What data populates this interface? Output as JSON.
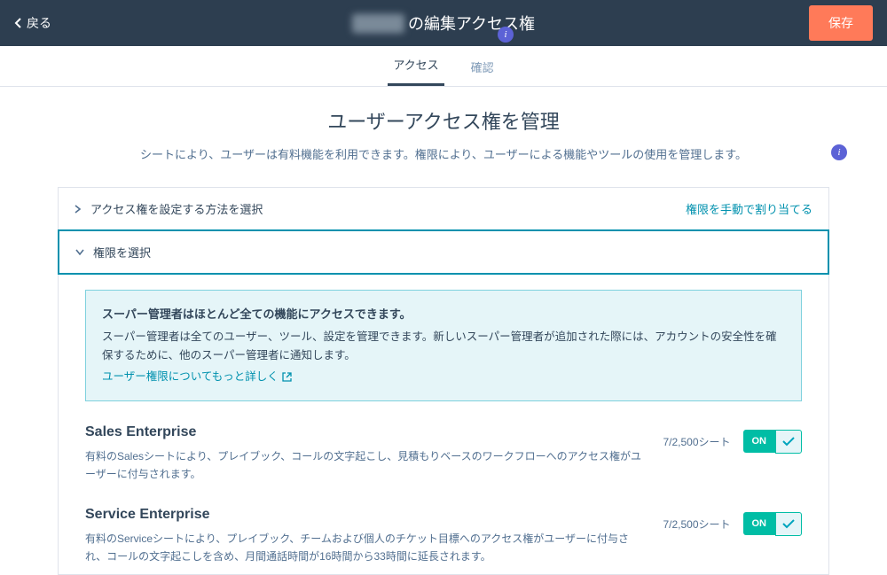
{
  "topbar": {
    "back": "戻る",
    "title_suffix": "の編集アクセス権",
    "save": "保存"
  },
  "tabs": {
    "access": "アクセス",
    "confirm": "確認"
  },
  "page": {
    "headline": "ユーザーアクセス権を管理",
    "subhead": "シートにより、ユーザーは有料機能を利用できます。権限により、ユーザーによる機能やツールの使用を管理します。"
  },
  "sections": {
    "method": "アクセス権を設定する方法を選択",
    "method_link": "権限を手動で割り当てる",
    "select": "権限を選択"
  },
  "callout": {
    "strong": "スーパー管理者はほとんど全ての機能にアクセスできます。",
    "body": "スーパー管理者は全てのユーザー、ツール、設定を管理できます。新しいスーパー管理者が追加された際には、アカウントの安全性を確保するために、他のスーパー管理者に通知します。",
    "link": "ユーザー権限についてもっと詳しく"
  },
  "features": [
    {
      "name": "Sales Enterprise",
      "desc": "有料のSalesシートにより、プレイブック、コールの文字起こし、見積もりベースのワークフローへのアクセス権がユーザーに付与されます。",
      "seats": "7/2,500シート",
      "toggle": "ON"
    },
    {
      "name": "Service Enterprise",
      "desc": "有料のServiceシートにより、プレイブック、チームおよび個人のチケット目標へのアクセス権がユーザーに付与され、コールの文字起こしを含め、月間通話時間が16時間から33時間に延長されます。",
      "seats": "7/2,500シート",
      "toggle": "ON"
    }
  ],
  "info_glyph": "i"
}
